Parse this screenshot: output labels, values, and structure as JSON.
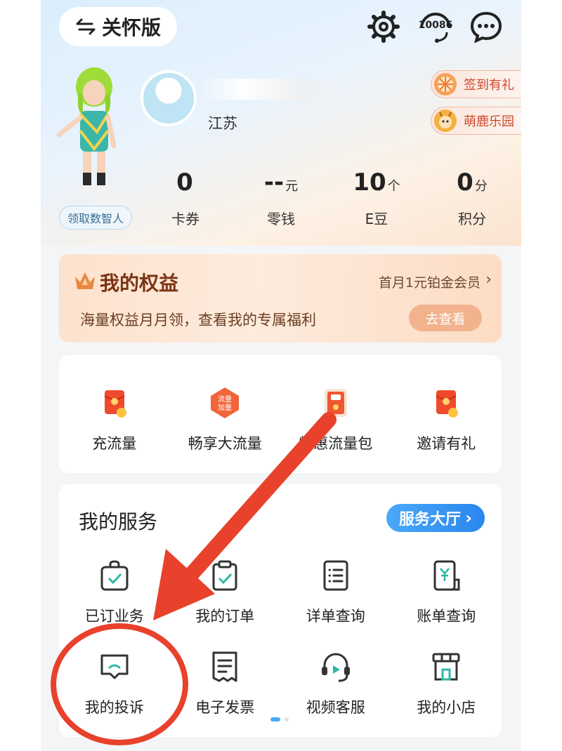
{
  "header": {
    "care_mode_label": "关怀版",
    "hotline_label": "10086"
  },
  "profile": {
    "claim_label": "领取数智人",
    "region": "江苏"
  },
  "badges": {
    "sign_in": "签到有礼",
    "park": "萌鹿乐园"
  },
  "stats": [
    {
      "value": "0",
      "unit": "",
      "label": "卡券"
    },
    {
      "value": "--",
      "unit": "元",
      "label": "零钱"
    },
    {
      "value": "10",
      "unit": "个",
      "label": "E豆"
    },
    {
      "value": "0",
      "unit": "分",
      "label": "积分"
    }
  ],
  "rights": {
    "title": "我的权益",
    "promo": "首月1元铂金会员",
    "desc": "海量权益月月领，查看我的专属福利",
    "button": "去查看"
  },
  "flow_items": [
    {
      "label": "充流量",
      "icon": "red-envelope-icon"
    },
    {
      "label": "畅享大流量",
      "icon": "flow-boost-icon",
      "icon_text_1": "流量",
      "icon_text_2": "加量"
    },
    {
      "label": "特惠流量包",
      "icon": "data-pack-icon"
    },
    {
      "label": "邀请有礼",
      "icon": "red-envelope-icon"
    }
  ],
  "services": {
    "title": "我的服务",
    "hall_button": "服务大厅",
    "items": [
      {
        "label": "已订业务",
        "icon": "bag-check-icon"
      },
      {
        "label": "我的订单",
        "icon": "clipboard-check-icon"
      },
      {
        "label": "详单查询",
        "icon": "list-doc-icon"
      },
      {
        "label": "账单查询",
        "icon": "bill-yen-icon"
      },
      {
        "label": "我的投诉",
        "icon": "complaint-chat-icon"
      },
      {
        "label": "电子发票",
        "icon": "receipt-icon"
      },
      {
        "label": "视频客服",
        "icon": "headset-icon"
      },
      {
        "label": "我的小店",
        "icon": "shop-icon"
      }
    ]
  },
  "colors": {
    "annotation_red": "#e8412c",
    "accent_blue": "#2a86ee",
    "rights_brown": "#7a3413"
  }
}
